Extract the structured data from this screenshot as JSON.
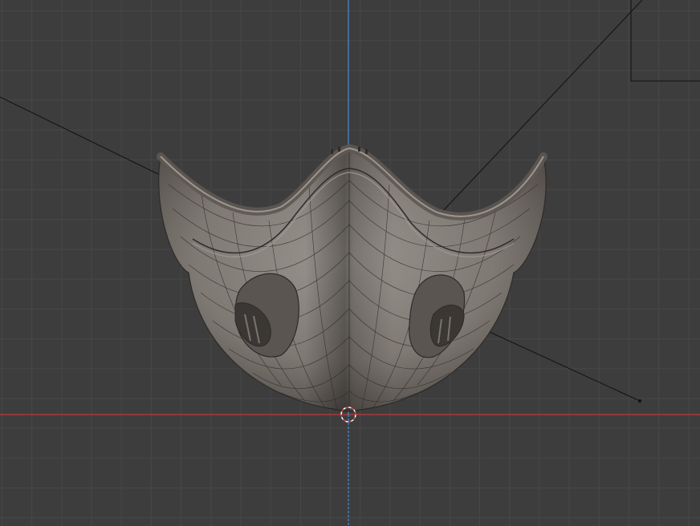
{
  "viewport": {
    "view": "front-orthographic",
    "background_color": "#3d3d3d",
    "grid_color": "#474747",
    "x_axis_color": "#c0383d",
    "z_axis_color": "#4a8cd6",
    "object": "face-mask",
    "object_color": "#8a847e",
    "wireframe_color": "#2f2b29"
  },
  "icons": {
    "cursor": "3d-cursor-icon",
    "light": "light-icon",
    "camera": "camera-icon"
  }
}
